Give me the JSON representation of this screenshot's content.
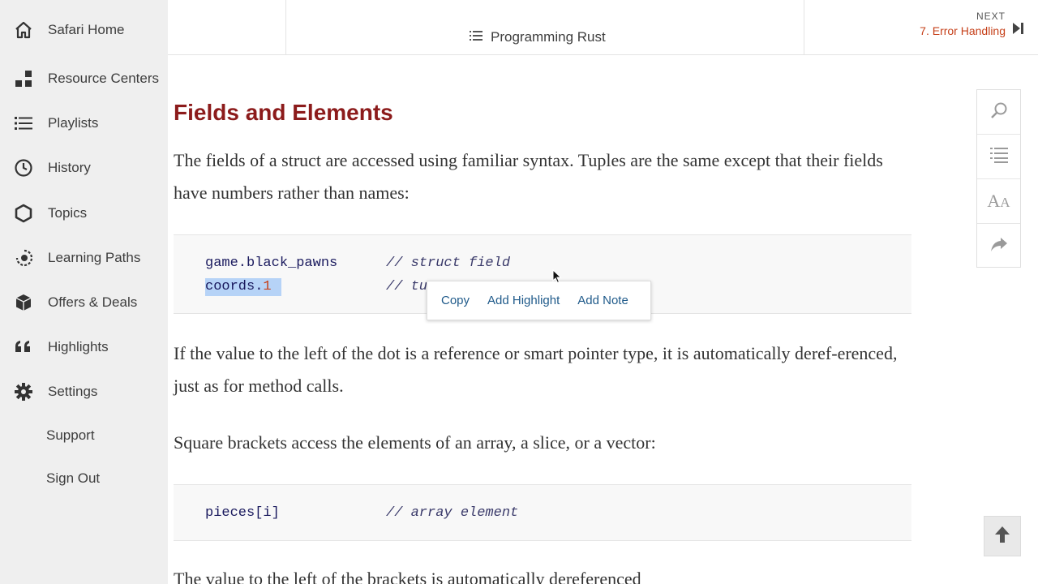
{
  "sidebar": {
    "items": [
      {
        "label": "Safari Home",
        "icon": "home-icon"
      },
      {
        "label": "Resource Centers",
        "icon": "resource-centers-icon"
      },
      {
        "label": "Playlists",
        "icon": "list-icon"
      },
      {
        "label": "History",
        "icon": "clock-icon"
      },
      {
        "label": "Topics",
        "icon": "hexagon-icon"
      },
      {
        "label": "Learning Paths",
        "icon": "learning-paths-icon"
      },
      {
        "label": "Offers & Deals",
        "icon": "cube-icon"
      },
      {
        "label": "Highlights",
        "icon": "quote-icon"
      },
      {
        "label": "Settings",
        "icon": "gear-icon"
      }
    ],
    "support": "Support",
    "sign_out": "Sign Out"
  },
  "header": {
    "book_title": "Programming Rust",
    "next_label": "NEXT",
    "next_chapter": "7. Error Handling"
  },
  "content": {
    "heading": "Fields and Elements",
    "para1": "The fields of a struct are accessed using familiar syntax. Tuples are the same except that their fields have numbers rather than names:",
    "code1": {
      "line1_code": "game.black_pawns",
      "line1_comment": "// struct field",
      "line2_code_prefix": "coords.",
      "line2_code_num": "1",
      "line2_comment": "// tu"
    },
    "para2": "If the value to the left of the dot is a reference or smart pointer type, it is automatically deref-erenced, just as for method calls.",
    "para3": "Square brackets access the elements of an array, a slice, or a vector:",
    "code2": {
      "line1_code": "pieces[i]",
      "line1_comment": "// array element"
    },
    "para4": "The value to the left of the brackets is automatically dereferenced"
  },
  "selection_popup": {
    "copy": "Copy",
    "add_highlight": "Add Highlight",
    "add_note": "Add Note"
  },
  "tools": [
    "search-icon",
    "table-of-contents-icon",
    "font-size-icon",
    "share-icon"
  ],
  "colors": {
    "accent": "#8c1b1b",
    "link": "#c6401a",
    "popup_link": "#1f5a8a",
    "sidebar_bg": "#efefef",
    "selection": "#b6d3f7"
  }
}
